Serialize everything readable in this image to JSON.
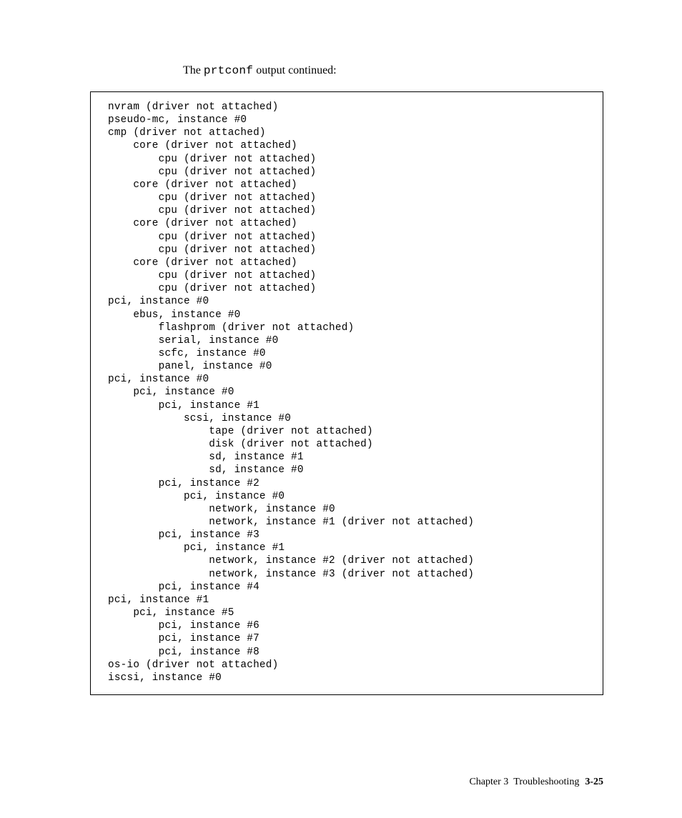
{
  "lead_prefix": "The ",
  "lead_cmd": "prtconf",
  "lead_suffix": " output continued:",
  "code": "nvram (driver not attached)\npseudo-mc, instance #0\ncmp (driver not attached)\n    core (driver not attached)\n        cpu (driver not attached)\n        cpu (driver not attached)\n    core (driver not attached)\n        cpu (driver not attached)\n        cpu (driver not attached)\n    core (driver not attached)\n        cpu (driver not attached)\n        cpu (driver not attached)\n    core (driver not attached)\n        cpu (driver not attached)\n        cpu (driver not attached)\npci, instance #0\n    ebus, instance #0\n        flashprom (driver not attached)\n        serial, instance #0\n        scfc, instance #0\n        panel, instance #0\npci, instance #0\n    pci, instance #0\n        pci, instance #1\n            scsi, instance #0\n                tape (driver not attached)\n                disk (driver not attached)\n                sd, instance #1\n                sd, instance #0\n        pci, instance #2\n            pci, instance #0\n                network, instance #0\n                network, instance #1 (driver not attached)\n        pci, instance #3\n            pci, instance #1\n                network, instance #2 (driver not attached)\n                network, instance #3 (driver not attached)\n        pci, instance #4\npci, instance #1\n    pci, instance #5\n        pci, instance #6\n        pci, instance #7\n        pci, instance #8\nos-io (driver not attached)\niscsi, instance #0",
  "footer_chapter": "Chapter 3",
  "footer_title": "Troubleshooting",
  "footer_page": "3-25"
}
